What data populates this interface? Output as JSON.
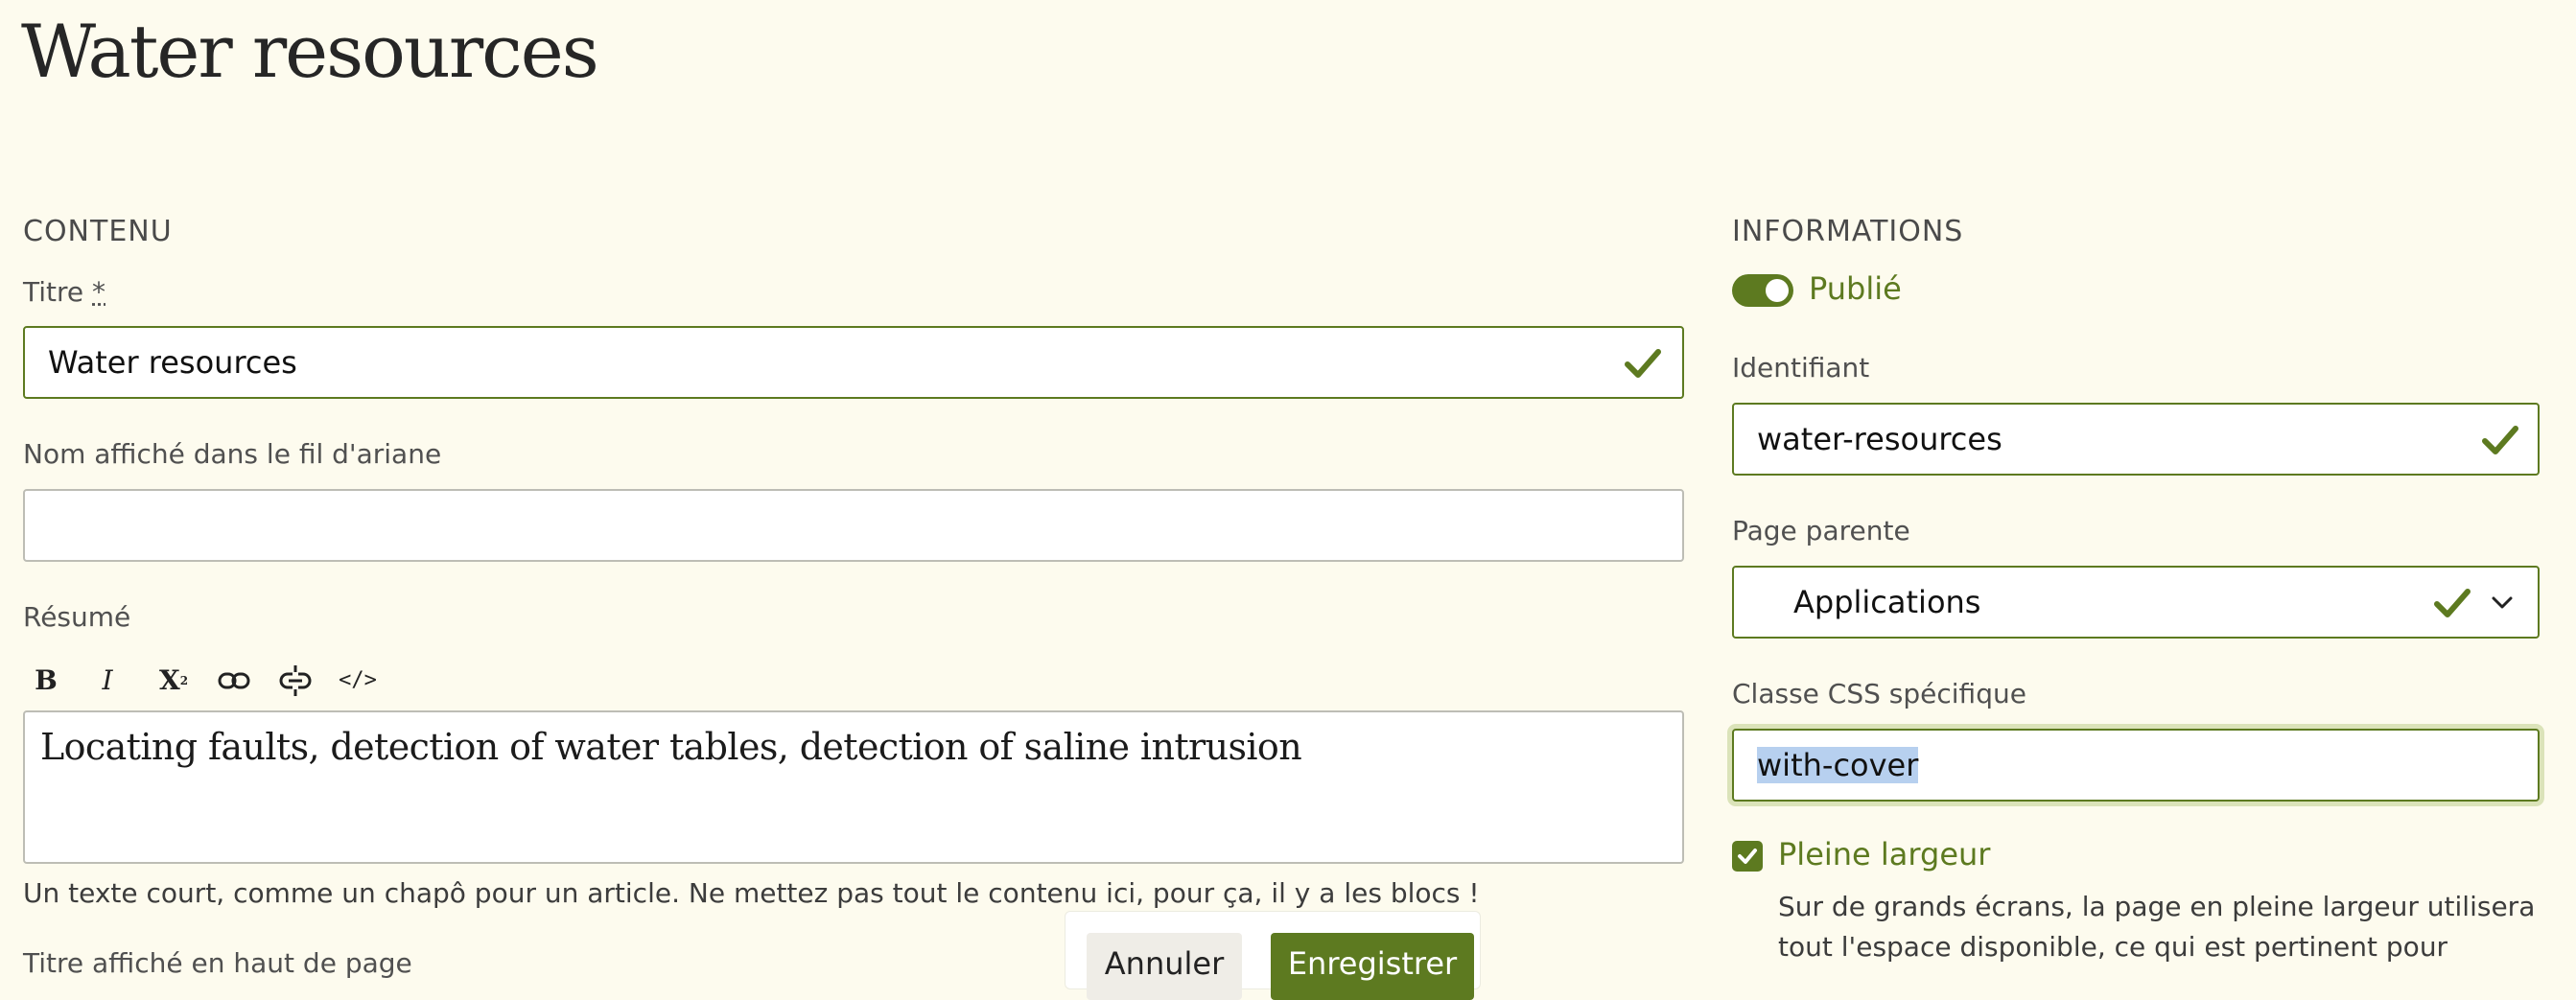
{
  "page": {
    "title": "Water resources"
  },
  "content": {
    "section_title": "CONTENU",
    "title_field": {
      "label": "Titre",
      "required_mark": "*",
      "value": "Water resources"
    },
    "breadcrumb_field": {
      "label": "Nom affiché dans le fil d'ariane",
      "value": ""
    },
    "summary": {
      "label": "Résumé",
      "toolbar": [
        {
          "name": "bold",
          "glyph": "B"
        },
        {
          "name": "italic",
          "glyph": "I"
        },
        {
          "name": "superscript",
          "glyph": "X²"
        },
        {
          "name": "link",
          "glyph": "link"
        },
        {
          "name": "unlink",
          "glyph": "unlink"
        },
        {
          "name": "code",
          "glyph": "</>"
        }
      ],
      "value": "Locating faults, detection of water tables, detection of saline intrusion",
      "help": "Un texte court, comme un chapô pour un article. Ne mettez pas tout le contenu ici, pour ça, il y a les blocs !"
    },
    "next_label": "Titre affiché en haut de page"
  },
  "info": {
    "section_title": "INFORMATIONS",
    "published": {
      "label": "Publié",
      "on": true
    },
    "identifier": {
      "label": "Identifiant",
      "value": "water-resources"
    },
    "parent_page": {
      "label": "Page parente",
      "value": "Applications"
    },
    "css_class": {
      "label": "Classe CSS spécifique",
      "value": "with-cover"
    },
    "full_width": {
      "label": "Pleine largeur",
      "checked": true,
      "help_line1": "Sur de grands écrans, la page en pleine largeur utilisera",
      "help_line2": "tout l'espace disponible, ce qui est pertinent pour"
    }
  },
  "actions": {
    "cancel": "Annuler",
    "save": "Enregistrer"
  },
  "colors": {
    "accent": "#5d7a20",
    "background": "#fdfbee",
    "selection": "#b7d0ef"
  }
}
